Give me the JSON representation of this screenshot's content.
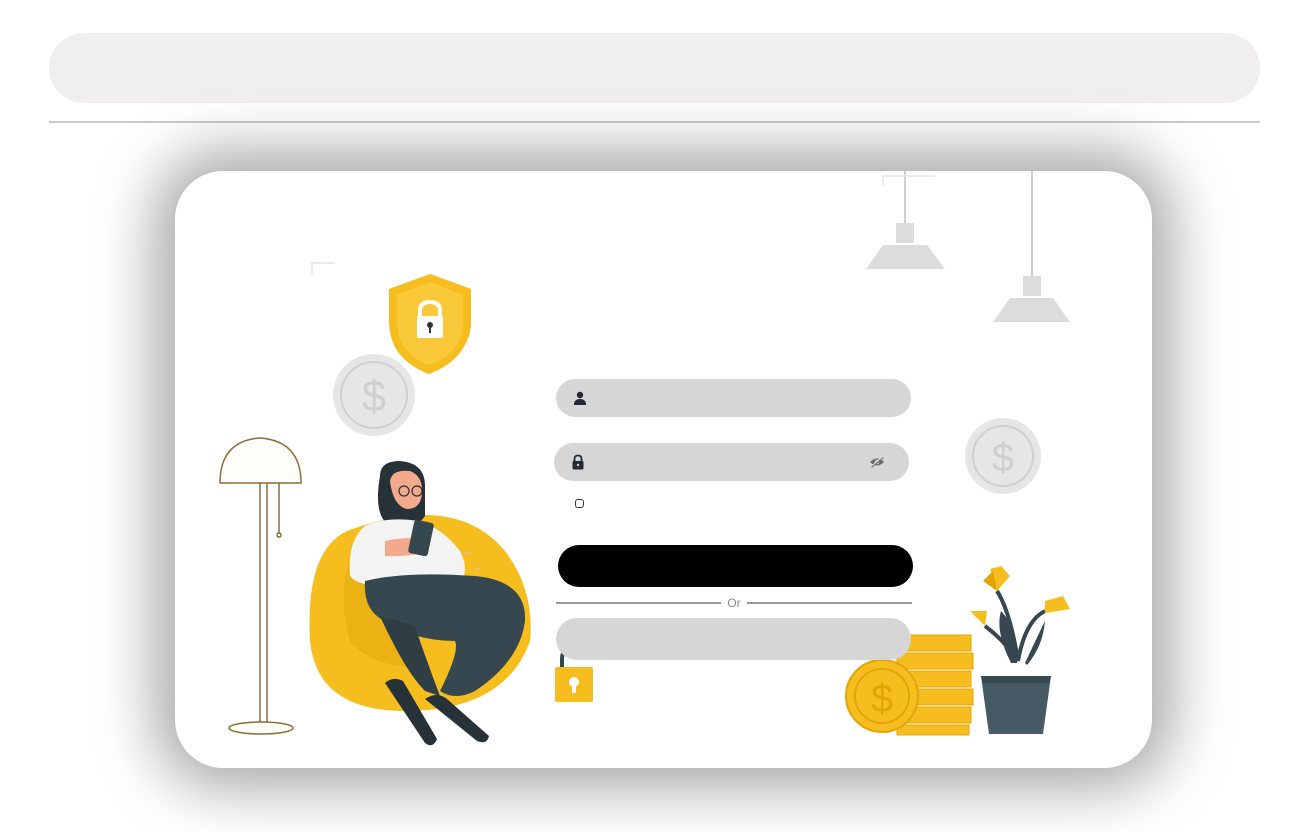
{
  "login_form": {
    "username_value": "",
    "password_value": "",
    "remember_checked": false,
    "login_label": "",
    "or_label": "Or",
    "alt_login_label": ""
  },
  "icons": {
    "username": "user-icon",
    "password": "lock-icon",
    "toggle_visibility": "eye-off-icon"
  },
  "colors": {
    "accent_yellow": "#F5BE1E",
    "field_gray": "#D6D6D6",
    "button_black": "#000000",
    "dark_teal": "#37474F"
  }
}
